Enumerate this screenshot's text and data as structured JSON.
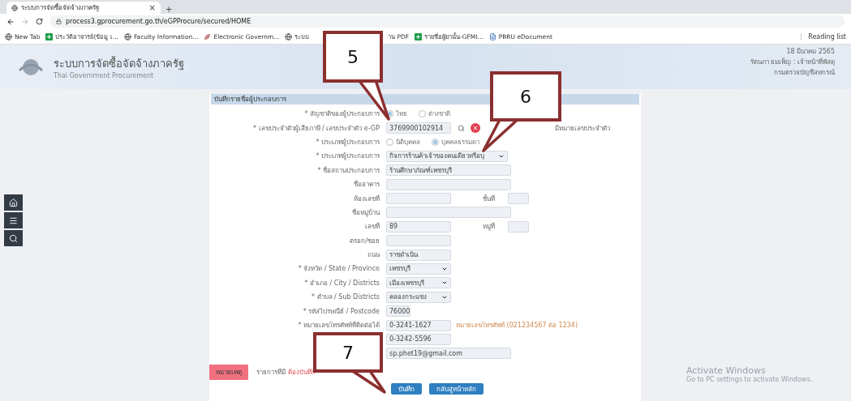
{
  "browser": {
    "tab_title": "ระบบการจัดซื้อจัดจ้างภาครัฐ",
    "tab_close": "×",
    "new_tab": "+",
    "url": "process3.gprocurement.go.th/eGPProcure/secured/HOME",
    "bookmarks": [
      {
        "label": "New Tab",
        "kind": "globe"
      },
      {
        "label": "ประวัติอาจารย์(ข้อมู เ...",
        "kind": "sheet"
      },
      {
        "label": "Faculty Information...",
        "kind": "globe"
      },
      {
        "label": "Electronic Governm...",
        "kind": "leaf"
      },
      {
        "label": "ระบบ",
        "kind": "globe"
      },
      {
        "label": "าน PDF",
        "kind": "none"
      },
      {
        "label": "รายชื่อผู้ยานั้น-GFMI...",
        "kind": "sheet"
      },
      {
        "label": "PBRU eDocument",
        "kind": "doc"
      }
    ],
    "reading_list": "Reading list"
  },
  "banner": {
    "title": "ระบบการจัดซื้อจัดจ้างภาครัฐ",
    "subtitle": "Thai Government Procurement",
    "date": "18 มีนาคม 2565",
    "user": "รัตนภา ยมเพ็ญ : เจ้าหน้าที่พัสดุ",
    "org": "กรมตรวจบัญชีสหกรณ์"
  },
  "sidebar": {
    "icons": [
      {
        "kind": "home"
      },
      {
        "kind": "menu"
      },
      {
        "kind": "search"
      }
    ]
  },
  "form": {
    "title": "บันทึกรายชื่อผู้ประกอบการ",
    "rows": [
      {
        "kind": "radio",
        "label": "* สัญชาติของผู้ประกอบการ",
        "options": [
          {
            "label": "ไทย",
            "selected": true
          },
          {
            "label": "ต่างชาติ",
            "selected": false
          }
        ]
      },
      {
        "kind": "taxid",
        "label": "* เลขประจำตัวผู้เสียภาษี / เลขประจำตัว e-GP",
        "value": "3769900102914",
        "hint": "มีหมายเลขประจำตัว"
      },
      {
        "kind": "radio",
        "label": "* ประเภทผู้ประกอบการ",
        "options": [
          {
            "label": "นิติบุคคล",
            "selected": false
          },
          {
            "label": "บุคคลธรรมดา",
            "selected": true
          }
        ]
      },
      {
        "kind": "combo",
        "label": "* ประเภทผู้ประกอบการ",
        "value": "กิจการร้านค้าเจ้าของคนเดียวหรือบุ"
      },
      {
        "kind": "wide",
        "label": "* ชื่อสถานประกอบการ",
        "value": "ร้านศึกษาภัณฑ์เพชรบุรี"
      },
      {
        "kind": "wide",
        "label": "ชื่ออาคาร"
      },
      {
        "kind": "pair",
        "label": "ห้องเลขที่",
        "label2": "ชั้นที่"
      },
      {
        "kind": "wide",
        "label": "ชื่อหมู่บ้าน"
      },
      {
        "kind": "pair",
        "label": "เลขที่",
        "value": "89",
        "label2": "หมู่ที่"
      },
      {
        "kind": "text",
        "label": "ตรอก/ซอย"
      },
      {
        "kind": "text",
        "label": "ถนน",
        "value": "ราชดำเนิน"
      },
      {
        "kind": "select",
        "label": "* จังหวัด / State / Province",
        "value": "เพชรบุรี"
      },
      {
        "kind": "select",
        "label": "* อำเภอ / City / Districts",
        "value": "เมืองเพชรบุรี"
      },
      {
        "kind": "select",
        "label": "* ตำบล / Sub Districts",
        "value": "คลองกระแชง"
      },
      {
        "kind": "code",
        "label": "* รหัสไปรษณีย์ / Postcode",
        "value": "76000"
      },
      {
        "kind": "text",
        "label": "* หมายเลขโทรศัพท์ที่ติดต่อได้",
        "value": "0-3241-1627",
        "hint": "หมายเลขโทรศัพท์ (021234567 ต่อ 1234)"
      },
      {
        "kind": "text",
        "value": "0-3242-5596"
      },
      {
        "kind": "wide",
        "value": "sp.phet19@gmail.com"
      }
    ],
    "note_badge": "หมายเหตุ",
    "note_text": "รายการที่มี",
    "note_required": "ต้องบันทึก",
    "buttons": [
      "บันทึก",
      "กลับสู่หน้าหลัก"
    ]
  },
  "callouts": [
    "5",
    "6",
    "7"
  ],
  "os_notice": {
    "title": "Activate Windows",
    "text": "Go to PC settings to activate Windows."
  }
}
